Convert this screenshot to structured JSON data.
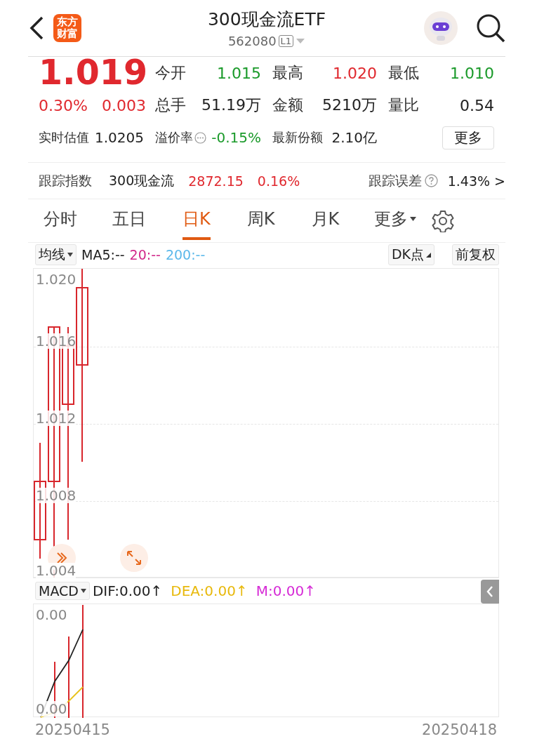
{
  "header": {
    "logo": "东方财富",
    "title": "300现金流ETF",
    "code": "562080",
    "badge": "L1"
  },
  "quote": {
    "price": "1.019",
    "change_pct": "0.30%",
    "change": "0.003",
    "color": "#e0282e",
    "stats": [
      {
        "label": "今开",
        "value": "1.015",
        "color": "#1a9a2a"
      },
      {
        "label": "最高",
        "value": "1.020",
        "color": "#e0282e"
      },
      {
        "label": "最低",
        "value": "1.010",
        "color": "#1a9a2a"
      },
      {
        "label": "总手",
        "value": "51.19万",
        "color": "#222222"
      },
      {
        "label": "金额",
        "value": "5210万",
        "color": "#222222"
      },
      {
        "label": "量比",
        "value": "0.54",
        "color": "#222222"
      }
    ],
    "extra": [
      {
        "label": "实时估值",
        "value": "1.0205",
        "color": "#222222",
        "info": false
      },
      {
        "label": "溢价率",
        "value": "-0.15%",
        "color": "#1a9a2a",
        "info": true
      },
      {
        "label": "最新份额",
        "value": "2.10亿",
        "color": "#222222",
        "info": false
      }
    ],
    "more_button": "更多"
  },
  "tracking": {
    "label": "跟踪指数",
    "index": "300现金流",
    "value": "2872.15",
    "change": "0.16%",
    "color": "#e0282e",
    "error_label": "跟踪误差",
    "error_value": "1.43% >"
  },
  "tabs": [
    {
      "label": "分时",
      "selected": false,
      "dropdown": false
    },
    {
      "label": "五日",
      "selected": false,
      "dropdown": false
    },
    {
      "label": "日K",
      "selected": true,
      "dropdown": false
    },
    {
      "label": "周K",
      "selected": false,
      "dropdown": false
    },
    {
      "label": "月K",
      "selected": false,
      "dropdown": false
    },
    {
      "label": "更多",
      "selected": false,
      "dropdown": true
    }
  ],
  "indicators": {
    "selector": "均线",
    "items": [
      {
        "text": "MA5:--",
        "color": "#222222"
      },
      {
        "text": "20:--",
        "color": "#d1288a"
      },
      {
        "text": "200:--",
        "color": "#5bb8ea"
      }
    ],
    "dk_button": "DK点",
    "adjust_button": "前复权"
  },
  "kline": {
    "y_ticks": [
      "1.020",
      "1.016",
      "1.012",
      "1.008",
      "1.004"
    ]
  },
  "macd": {
    "selector": "MACD",
    "items": [
      {
        "text": "DIF:0.00↑",
        "color": "#222222"
      },
      {
        "text": "DEA:0.00↑",
        "color": "#e8b90c"
      },
      {
        "text": "M:0.00↑",
        "color": "#d62bd6"
      }
    ],
    "y_ticks": [
      "0.00",
      "0.00"
    ]
  },
  "dates": [
    "20250415",
    "20250418"
  ]
}
